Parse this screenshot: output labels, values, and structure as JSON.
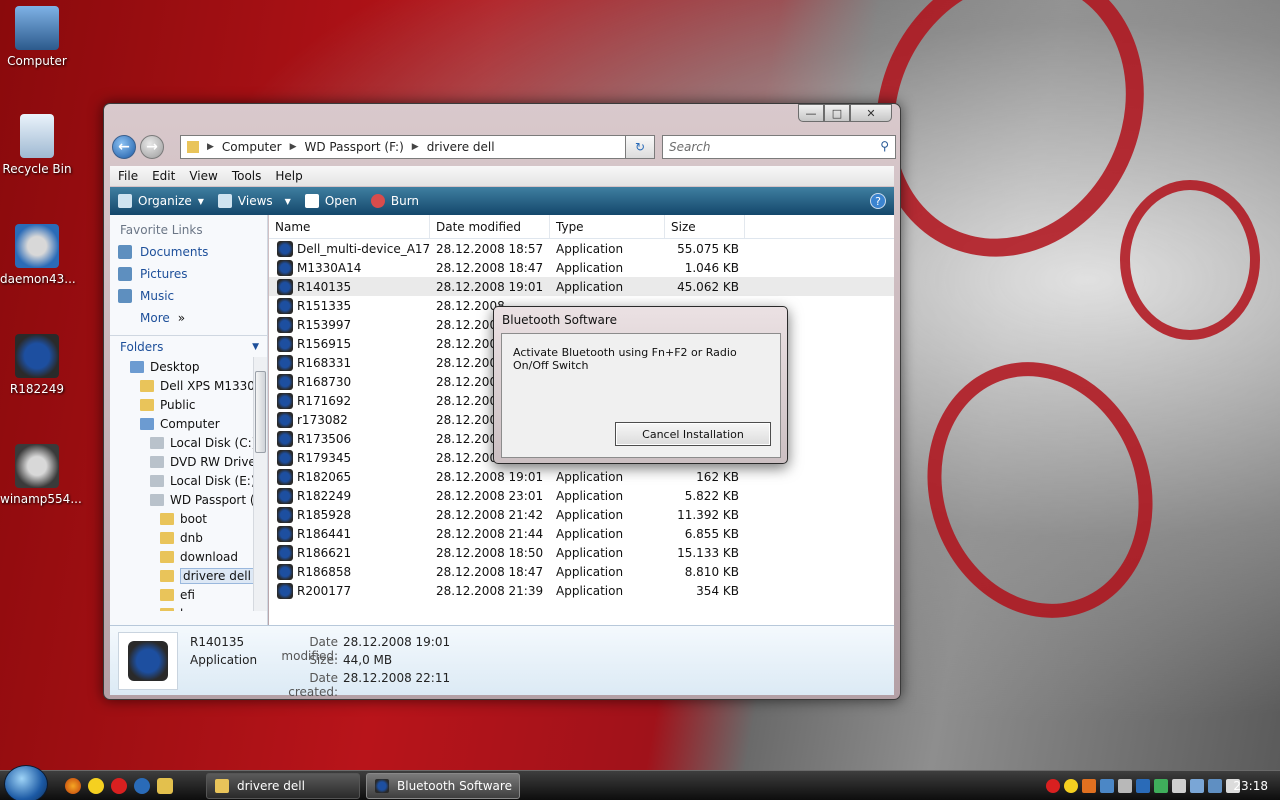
{
  "desktop": {
    "icons": [
      {
        "label": "Computer"
      },
      {
        "label": "Recycle Bin"
      },
      {
        "label": "daemon43..."
      },
      {
        "label": "R182249"
      },
      {
        "label": "winamp554..."
      }
    ]
  },
  "explorer": {
    "breadcrumb": [
      "Computer",
      "WD Passport (F:)",
      "drivere dell"
    ],
    "search_placeholder": "Search",
    "menu": [
      "File",
      "Edit",
      "View",
      "Tools",
      "Help"
    ],
    "toolbar": {
      "organize": "Organize",
      "views": "Views",
      "open": "Open",
      "burn": "Burn"
    },
    "favorites_title": "Favorite Links",
    "favorites": [
      "Documents",
      "Pictures",
      "Music"
    ],
    "more_label": "More",
    "folders_label": "Folders",
    "tree": [
      {
        "label": "Desktop",
        "indent": 0,
        "kind": "pc"
      },
      {
        "label": "Dell XPS M1330",
        "indent": 1,
        "kind": "folder"
      },
      {
        "label": "Public",
        "indent": 1,
        "kind": "folder"
      },
      {
        "label": "Computer",
        "indent": 1,
        "kind": "pc"
      },
      {
        "label": "Local Disk (C:)",
        "indent": 2,
        "kind": "drive"
      },
      {
        "label": "DVD RW Drive",
        "indent": 2,
        "kind": "drive"
      },
      {
        "label": "Local Disk (E:)",
        "indent": 2,
        "kind": "drive"
      },
      {
        "label": "WD Passport (F",
        "indent": 2,
        "kind": "drive"
      },
      {
        "label": "boot",
        "indent": 3,
        "kind": "folder"
      },
      {
        "label": "dnb",
        "indent": 3,
        "kind": "folder"
      },
      {
        "label": "download",
        "indent": 3,
        "kind": "folder"
      },
      {
        "label": "drivere dell",
        "indent": 3,
        "kind": "folder",
        "selected": true
      },
      {
        "label": "efi",
        "indent": 3,
        "kind": "folder"
      },
      {
        "label": "house",
        "indent": 3,
        "kind": "folder"
      }
    ],
    "columns": [
      "Name",
      "Date modified",
      "Type",
      "Size"
    ],
    "files": [
      {
        "name": "Dell_multi-device_A17...",
        "date": "28.12.2008 18:57",
        "type": "Application",
        "size": "55.075 KB"
      },
      {
        "name": "M1330A14",
        "date": "28.12.2008 18:47",
        "type": "Application",
        "size": "1.046 KB"
      },
      {
        "name": "R140135",
        "date": "28.12.2008 19:01",
        "type": "Application",
        "size": "45.062 KB",
        "selected": true
      },
      {
        "name": "R151335",
        "date": "28.12.2008",
        "type": "",
        "size": ""
      },
      {
        "name": "R153997",
        "date": "28.12.2008",
        "type": "",
        "size": ""
      },
      {
        "name": "R156915",
        "date": "28.12.2008",
        "type": "",
        "size": ""
      },
      {
        "name": "R168331",
        "date": "28.12.2008",
        "type": "",
        "size": ""
      },
      {
        "name": "R168730",
        "date": "28.12.2008",
        "type": "",
        "size": ""
      },
      {
        "name": "R171692",
        "date": "28.12.2008",
        "type": "",
        "size": ""
      },
      {
        "name": "r173082",
        "date": "28.12.2008",
        "type": "",
        "size": ""
      },
      {
        "name": "R173506",
        "date": "28.12.2008",
        "type": "",
        "size": ""
      },
      {
        "name": "R179345",
        "date": "28.12.2008",
        "type": "",
        "size": ""
      },
      {
        "name": "R182065",
        "date": "28.12.2008 19:01",
        "type": "Application",
        "size": "162 KB"
      },
      {
        "name": "R182249",
        "date": "28.12.2008 23:01",
        "type": "Application",
        "size": "5.822 KB"
      },
      {
        "name": "R185928",
        "date": "28.12.2008 21:42",
        "type": "Application",
        "size": "11.392 KB"
      },
      {
        "name": "R186441",
        "date": "28.12.2008 21:44",
        "type": "Application",
        "size": "6.855 KB"
      },
      {
        "name": "R186621",
        "date": "28.12.2008 18:50",
        "type": "Application",
        "size": "15.133 KB"
      },
      {
        "name": "R186858",
        "date": "28.12.2008 18:47",
        "type": "Application",
        "size": "8.810 KB"
      },
      {
        "name": "R200177",
        "date": "28.12.2008 21:39",
        "type": "Application",
        "size": "354 KB"
      }
    ],
    "details": {
      "name": "R140135",
      "type": "Application",
      "modified_label": "Date modified:",
      "modified": "28.12.2008 19:01",
      "size_label": "Size:",
      "size": "44,0 MB",
      "created_label": "Date created:",
      "created": "28.12.2008 22:11"
    }
  },
  "dialog": {
    "title": "Bluetooth Software",
    "message": "Activate Bluetooth using Fn+F2 or Radio On/Off Switch",
    "button": "Cancel Installation"
  },
  "taskbar": {
    "tasks": [
      "drivere dell",
      "Bluetooth Software"
    ],
    "clock": "23:18"
  }
}
